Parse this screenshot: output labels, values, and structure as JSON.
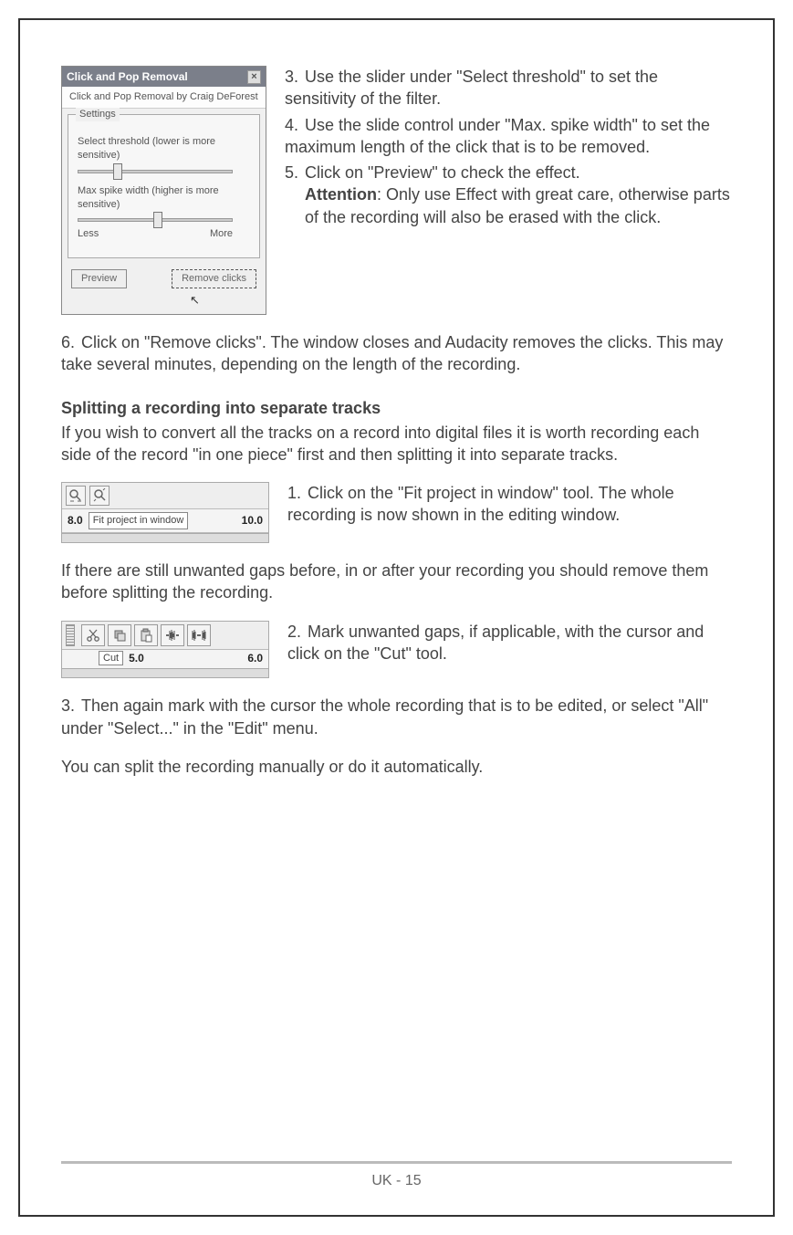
{
  "dialog1": {
    "title": "Click and Pop Removal",
    "close": "×",
    "subtitle": "Click and Pop Removal by Craig DeForest",
    "legend": "Settings",
    "slider1_label": "Select threshold (lower is more sensitive)",
    "slider2_label": "Max spike width (higher is more sensitive)",
    "min_label": "Less",
    "max_label": "More",
    "preview_btn": "Preview",
    "remove_btn": "Remove clicks"
  },
  "instr_a": {
    "i3": "Use the slider under \"Select threshold\" to set the sensitivity of the filter.",
    "i4": "Use the slide control under \"Max. spike width\" to set the maximum length of the click that is to be removed.",
    "i5a": "Click on \"Preview\" to check the effect.",
    "i5b_bold": "Attention",
    "i5b_rest": ": Only use Effect with great care, otherwise parts of the recording will also be erased with the click.",
    "i6": "Click on \"Remove clicks\". The window closes and Audacity removes the clicks. This may take several minutes, depending on the length of the recording."
  },
  "section2_title": "Splitting a recording into separate tracks",
  "section2_intro": "If you wish to convert all the tracks on a record into digital files it is worth recording each side of the record \"in one piece\" first and then splitting it into separate tracks.",
  "toolbar2": {
    "ruler_left": "8.0",
    "tooltip": "Fit project in window",
    "ruler_right": "10.0"
  },
  "instr_b": {
    "i1": "Click on the \"Fit project in window\" tool. The whole recording is now shown in the editing window."
  },
  "gap_para": "If there are still unwanted gaps before, in or after your recording you should remove them before splitting the recording.",
  "toolbar3": {
    "tooltip": "Cut",
    "ruler_mid": "5.0",
    "ruler_right": "6.0"
  },
  "instr_c": {
    "i2": "Mark unwanted gaps, if applicable, with the cursor and click on the \"Cut\" tool.",
    "i3": "Then again mark with the cursor the whole recording that is to be edited, or select \"All\" under \"Select...\" in the \"Edit\" menu."
  },
  "closing": "You can split the recording manually or do it automatically.",
  "footer": "UK - 15"
}
